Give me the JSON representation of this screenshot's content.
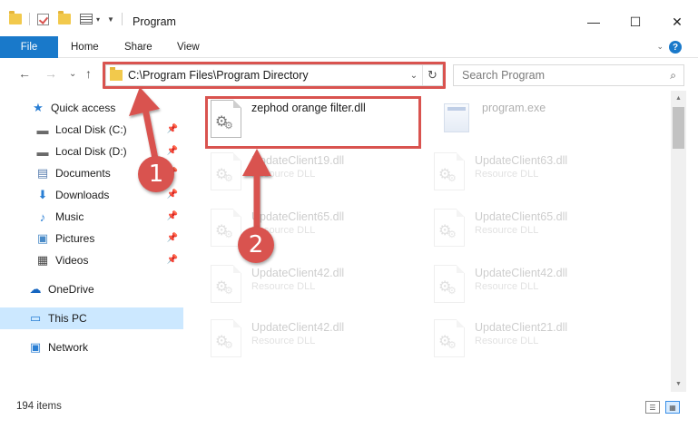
{
  "window": {
    "title": "Program",
    "minimize": "—",
    "maximize": "☐",
    "close": "✕"
  },
  "ribbon": {
    "file": "File",
    "home": "Home",
    "share": "Share",
    "view": "View",
    "expand": "⌄",
    "help": "?"
  },
  "nav": {
    "back": "←",
    "forward": "→",
    "recent": "⌄",
    "up": "↑",
    "address": "C:\\Program Files\\Program Directory",
    "address_dropdown": "⌄",
    "refresh": "↻",
    "search_placeholder": "Search Program",
    "search_icon": "⌕"
  },
  "sidebar": {
    "items": [
      {
        "label": "Quick access",
        "icon": "star-icon"
      },
      {
        "label": "Local Disk (C:)",
        "icon": "drive-icon"
      },
      {
        "label": "Local Disk (D:)",
        "icon": "drive-icon"
      },
      {
        "label": "Documents",
        "icon": "documents-icon"
      },
      {
        "label": "Downloads",
        "icon": "download-icon"
      },
      {
        "label": "Music",
        "icon": "music-icon"
      },
      {
        "label": "Pictures",
        "icon": "pictures-icon"
      },
      {
        "label": "Videos",
        "icon": "videos-icon"
      },
      {
        "label": "OneDrive",
        "icon": "cloud-icon"
      },
      {
        "label": "This PC",
        "icon": "computer-icon"
      },
      {
        "label": "Network",
        "icon": "network-icon"
      }
    ]
  },
  "files": {
    "highlighted": {
      "name": "zephod orange filter.dll"
    },
    "exe": {
      "name": "program.exe"
    },
    "grid": [
      {
        "name": "UpdateClient19.dll",
        "type": "Resource DLL"
      },
      {
        "name": "UpdateClient63.dll",
        "type": "Resource DLL"
      },
      {
        "name": "UpdateClient65.dll",
        "type": "Resource DLL"
      },
      {
        "name": "UpdateClient65.dll",
        "type": "Resource DLL"
      },
      {
        "name": "UpdateClient42.dll",
        "type": "Resource DLL"
      },
      {
        "name": "UpdateClient42.dll",
        "type": "Resource DLL"
      },
      {
        "name": "UpdateClient42.dll",
        "type": "Resource DLL"
      },
      {
        "name": "UpdateClient21.dll",
        "type": "Resource DLL"
      }
    ]
  },
  "status": {
    "count": "194 items"
  },
  "annotations": {
    "step1": "1",
    "step2": "2",
    "color": "#d9534f"
  }
}
